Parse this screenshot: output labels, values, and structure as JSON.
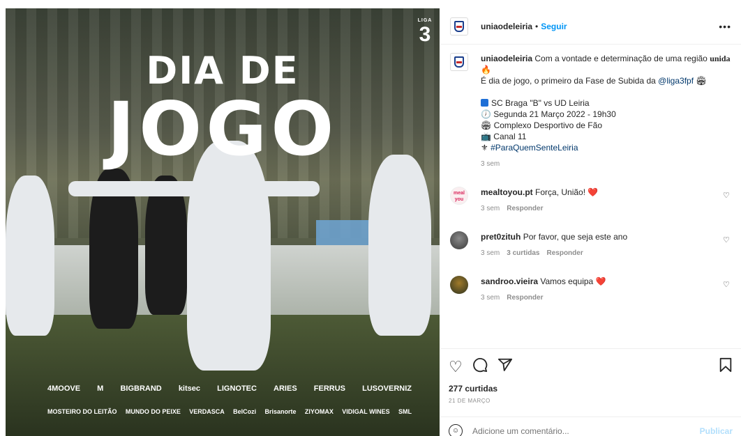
{
  "post_image": {
    "title_line1": "DIA DE",
    "title_line2": "JOGO",
    "league_badge": "3",
    "league_badge_top": "LIGA",
    "sponsors_row1": [
      "4MOOVE",
      "M",
      "BIGBRAND",
      "kitsec",
      "LIGNOTEC",
      "ARIES",
      "FERRUS",
      "LUSOVERNIZ"
    ],
    "sponsors_row2": [
      "MOSTEIRO DO LEITÃO",
      "MUNDO DO PEIXE",
      "VERDASCA",
      "BelCozi",
      "Brisanorte",
      "ZIYOMAX",
      "VIDIGAL WINES",
      "SML"
    ]
  },
  "header": {
    "username": "uniaodeleiria",
    "separator": "•",
    "follow_label": "Seguir",
    "more_icon": "more-horizontal-icon"
  },
  "caption": {
    "username": "uniaodeleiria",
    "text_start": "Com a vontade e determinação de uma região ",
    "text_bold": "unida",
    "line_emoji": "🔥",
    "line2_text": "É dia de jogo, o primeiro da Fase de Subida da ",
    "line2_mention": "@liga3fpf",
    "line2_emoji": "🏟",
    "match": "SC Braga \"B\" vs UD Leiria",
    "datetime": "Segunda 21 Março 2022 - 19h30",
    "venue": "Complexo Desportivo de Fão",
    "tv": "Canal 11",
    "hashtag": "#ParaQuemSenteLeiria",
    "time_ago": "3 sem"
  },
  "comments": [
    {
      "username": "mealtoyou.pt",
      "text": "Força, União! ❤️",
      "time": "3 sem",
      "likes": "",
      "reply": "Responder",
      "avatar_text": "meal you"
    },
    {
      "username": "pret0zituh",
      "text": "Por favor, que seja este ano",
      "time": "3 sem",
      "likes": "3 curtidas",
      "reply": "Responder"
    },
    {
      "username": "sandroo.vieira",
      "text": "Vamos equipa ❤️",
      "time": "3 sem",
      "likes": "",
      "reply": "Responder"
    }
  ],
  "actions": {
    "like_icon": "heart-icon",
    "comment_icon": "comment-icon",
    "share_icon": "send-icon",
    "save_icon": "bookmark-icon",
    "likes_count": "277 curtidas",
    "date": "21 DE MARÇO"
  },
  "add_comment": {
    "placeholder": "Adicione um comentário...",
    "publish_label": "Publicar"
  }
}
